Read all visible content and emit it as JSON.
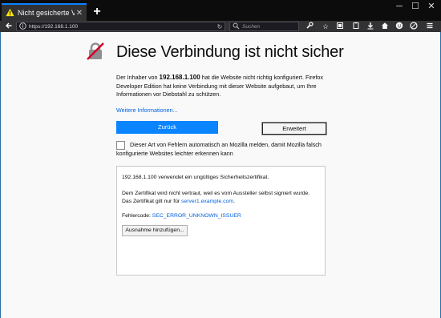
{
  "browser": {
    "tab_title": "Nicht gesicherte Verbindu...",
    "url": "https://192.168.1.100",
    "search_placeholder": "Suchen"
  },
  "page": {
    "title": "Diese Verbindung ist nicht sicher",
    "p1_before": "Der Inhaber von ",
    "p1_host": "192.168.1.100",
    "p1_after": " hat die Website nicht richtig konfiguriert. Firefox Developer Edition hat keine Verbindung mit dieser Website aufgebaut, um Ihre Informationen vor Diebstahl zu schützen.",
    "more_info": "Weitere Informationen...",
    "back_button": "Zurück",
    "advanced_button": "Erweitert",
    "report_checkbox_label": "Dieser Art von Fehlern automatisch an Mozilla melden, damit Mozilla falsch konfigurierte Websites leichter erkennen kann"
  },
  "advanced": {
    "line1": "192.168.1.100 verwendet ein ungültiges Sicherheitszertifikat.",
    "line2": "Dem Zertifikat wird nicht vertraut, weil es vom Aussteller selbst signiert wurde.",
    "line3_before": "Das Zertifikat gilt nur für ",
    "line3_link": "server1.example.com",
    "line3_after": ".",
    "error_label": "Fehlercode: ",
    "error_code": "SEC_ERROR_UNKNOWN_ISSUER",
    "add_exception": "Ausnahme hinzufügen..."
  },
  "colors": {
    "accent": "#0a84ff",
    "link": "#0060df",
    "titlebar": "#0c0c0d",
    "toolbar": "#323234",
    "warning": "#ffe900",
    "page_bg": "#f9f9fa"
  }
}
